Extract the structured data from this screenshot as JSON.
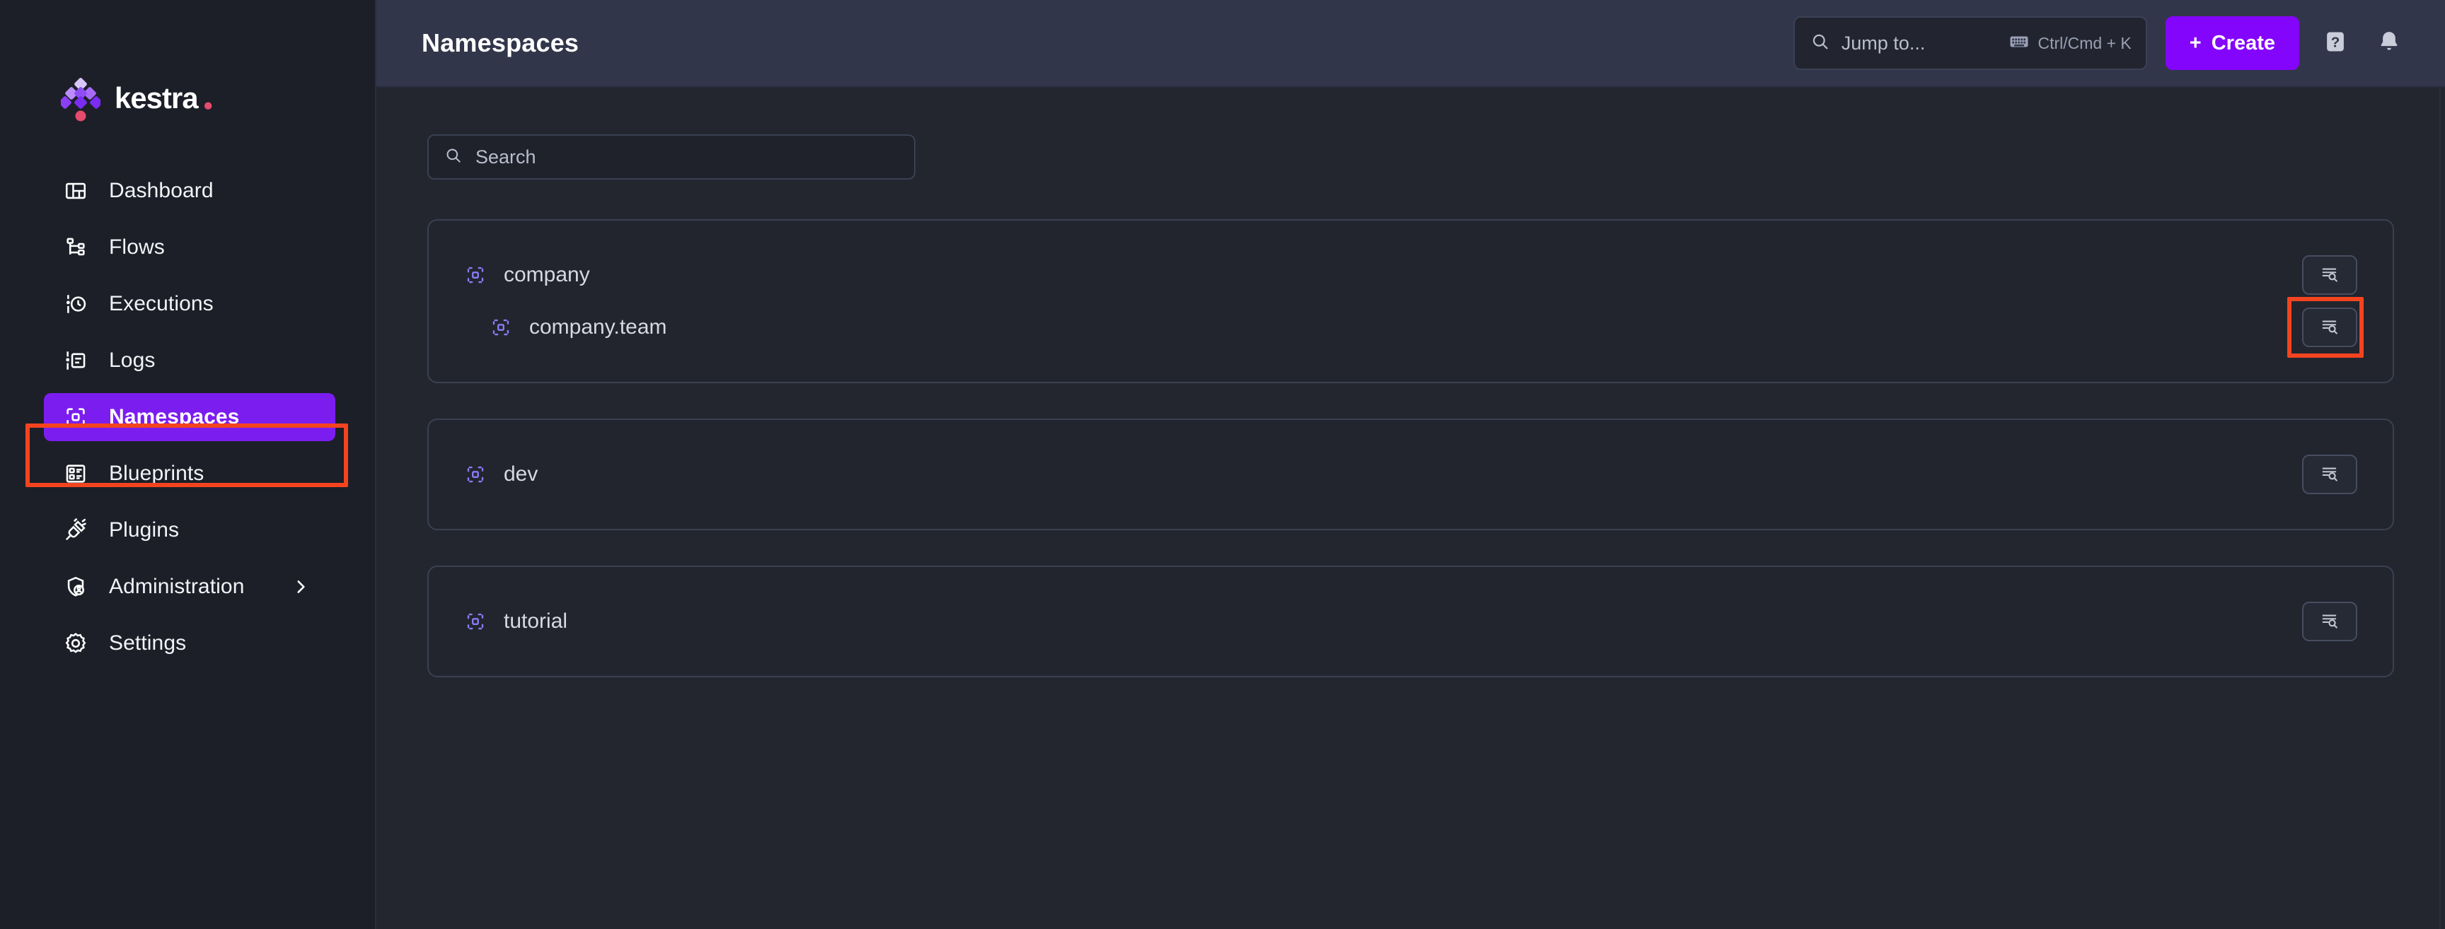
{
  "brand": {
    "name": "kestra",
    "logo_icon": "kestra-diamond-logo"
  },
  "sidebar": {
    "items": [
      {
        "label": "Dashboard",
        "icon": "dashboard-icon",
        "active": false,
        "has_chevron": false
      },
      {
        "label": "Flows",
        "icon": "flows-icon",
        "active": false,
        "has_chevron": false
      },
      {
        "label": "Executions",
        "icon": "executions-icon",
        "active": false,
        "has_chevron": false
      },
      {
        "label": "Logs",
        "icon": "logs-icon",
        "active": false,
        "has_chevron": false
      },
      {
        "label": "Namespaces",
        "icon": "namespaces-icon",
        "active": true,
        "has_chevron": false
      },
      {
        "label": "Blueprints",
        "icon": "blueprints-icon",
        "active": false,
        "has_chevron": false
      },
      {
        "label": "Plugins",
        "icon": "plugins-icon",
        "active": false,
        "has_chevron": false
      },
      {
        "label": "Administration",
        "icon": "administration-icon",
        "active": false,
        "has_chevron": true
      },
      {
        "label": "Settings",
        "icon": "settings-gear-icon",
        "active": false,
        "has_chevron": false
      }
    ]
  },
  "header": {
    "title": "Namespaces",
    "jump_to": {
      "placeholder": "Jump to...",
      "search_icon": "search-icon",
      "keyboard_icon": "keyboard-icon",
      "shortcut": "Ctrl/Cmd + K"
    },
    "create_button": {
      "label": "Create",
      "plus": "+"
    },
    "help_icon": "help-question-icon",
    "notifications_icon": "bell-icon"
  },
  "content": {
    "search": {
      "placeholder": "Search",
      "icon": "search-icon"
    },
    "cards": [
      {
        "rows": [
          {
            "label": "company",
            "icon": "namespace-icon",
            "indent": false,
            "action_icon": "list-search-icon",
            "annotated": false
          },
          {
            "label": "company.team",
            "icon": "namespace-icon",
            "indent": true,
            "action_icon": "list-search-icon",
            "annotated": true
          }
        ]
      },
      {
        "rows": [
          {
            "label": "dev",
            "icon": "namespace-icon",
            "indent": false,
            "action_icon": "list-search-icon",
            "annotated": false
          }
        ]
      },
      {
        "rows": [
          {
            "label": "tutorial",
            "icon": "namespace-icon",
            "indent": false,
            "action_icon": "list-search-icon",
            "annotated": false
          }
        ]
      }
    ]
  },
  "colors": {
    "accent_purple": "#8405fb",
    "active_nav_purple": "#7c1df0",
    "annotation_red": "#f4441f",
    "namespace_icon_purple": "#8b7cf6",
    "sidebar_bg": "#1c1f28",
    "header_bg": "#32364a",
    "content_bg": "#23262f",
    "logo_pink": "#e54b6d"
  }
}
